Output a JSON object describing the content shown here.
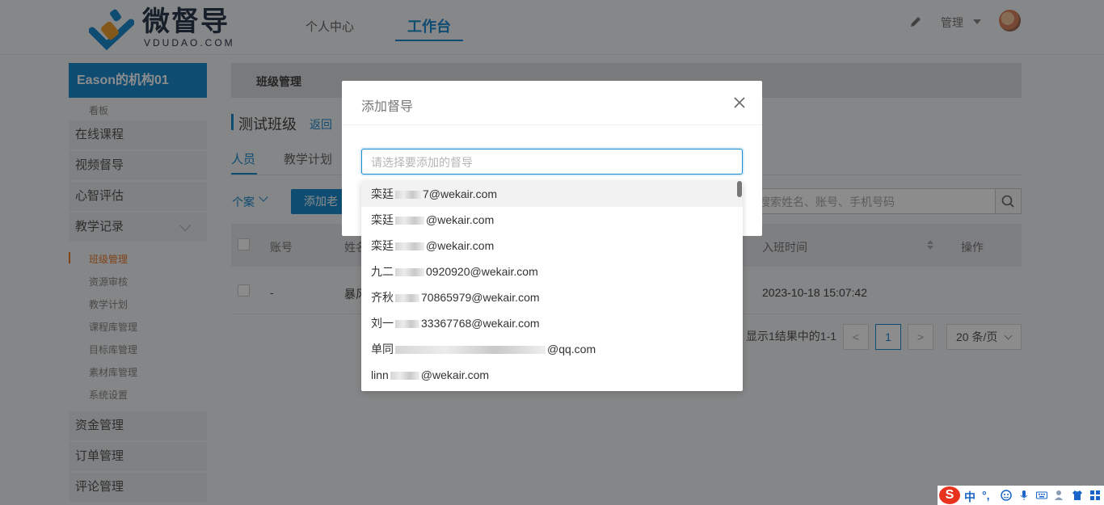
{
  "header": {
    "logo_text": "微督导",
    "logo_sub": "VDUDAO.COM",
    "nav": [
      {
        "label": "个人中心"
      },
      {
        "label": "工作台"
      }
    ],
    "admin_label": "管理"
  },
  "sidebar": {
    "org_title": "Eason的机构01",
    "board_label": "看板",
    "items": [
      {
        "label": "在线课程"
      },
      {
        "label": "视频督导"
      },
      {
        "label": "心智评估"
      },
      {
        "label": "教学记录"
      }
    ],
    "sub_links": [
      {
        "label": "班级管理"
      },
      {
        "label": "资源审核"
      },
      {
        "label": "教学计划"
      },
      {
        "label": "课程库管理"
      },
      {
        "label": "目标库管理"
      },
      {
        "label": "素材库管理"
      },
      {
        "label": "系统设置"
      }
    ],
    "bottom_items": [
      {
        "label": "资金管理"
      },
      {
        "label": "订单管理"
      },
      {
        "label": "评论管理"
      }
    ]
  },
  "main": {
    "head_title": "班级管理",
    "class_title": "测试班级",
    "back_link": "返回",
    "tabs": [
      {
        "label": "人员"
      },
      {
        "label": "教学计划"
      }
    ],
    "filter_label": "个案",
    "add_teacher_label": "添加老师",
    "search_placeholder": "搜索姓名、账号、手机号码",
    "table": {
      "headers": [
        "账号",
        "姓名",
        "入班时间",
        "操作"
      ],
      "row": {
        "account": "-",
        "name": "暴风",
        "join_time": "2023-10-18 15:07:42"
      }
    },
    "pager": {
      "summary": "显示1结果中的1-1",
      "prev": "<",
      "current": "1",
      "next": ">",
      "page_size": "20 条/页"
    }
  },
  "modal": {
    "title": "添加督导",
    "select_placeholder": "请选择要添加的督导",
    "options": [
      {
        "prefix": "栾廷",
        "suffix": "7@wekair.com"
      },
      {
        "prefix": "栾廷",
        "suffix": "@wekair.com"
      },
      {
        "prefix": "栾廷",
        "suffix": "@wekair.com"
      },
      {
        "prefix": "九二",
        "suffix": "0920920@wekair.com"
      },
      {
        "prefix": "齐秋",
        "suffix": "70865979@wekair.com"
      },
      {
        "prefix": "刘一",
        "suffix": "33367768@wekair.com"
      },
      {
        "prefix": "单同",
        "suffix": "@qq.com"
      },
      {
        "prefix": "linn",
        "suffix": "@wekair.com"
      }
    ]
  },
  "ime": {
    "logo": "S",
    "lang": "中",
    "punct": "°,"
  },
  "colors": {
    "brand_blue": "#1b8bd0",
    "active_orange": "#e57a2c",
    "overlay": "rgba(0,0,0,0.45)"
  }
}
